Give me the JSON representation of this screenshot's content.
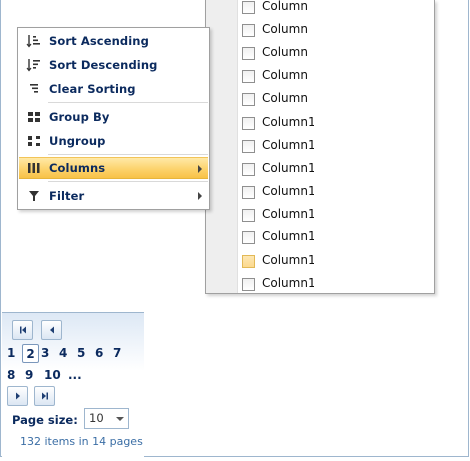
{
  "context_menu": {
    "items": [
      {
        "label": "Sort Ascending",
        "icon": "sort-ascending-icon"
      },
      {
        "label": "Sort Descending",
        "icon": "sort-descending-icon"
      },
      {
        "label": "Clear Sorting",
        "icon": "clear-sorting-icon"
      },
      {
        "label": "Group By",
        "icon": "group-by-icon"
      },
      {
        "label": "Ungroup",
        "icon": "ungroup-icon"
      },
      {
        "label": "Columns",
        "icon": "columns-icon",
        "has_submenu": true,
        "highlighted": true
      },
      {
        "label": "Filter",
        "icon": "filter-icon",
        "has_submenu": true
      }
    ],
    "highlight_color": "#fcd36d"
  },
  "columns_submenu": {
    "items": [
      {
        "label": "Column"
      },
      {
        "label": "Column"
      },
      {
        "label": "Column"
      },
      {
        "label": "Column"
      },
      {
        "label": "Column"
      },
      {
        "label": "Column1"
      },
      {
        "label": "Column1"
      },
      {
        "label": "Column1"
      },
      {
        "label": "Column1"
      },
      {
        "label": "Column1"
      },
      {
        "label": "Column1"
      },
      {
        "label": "Column1",
        "hover": true
      },
      {
        "label": "Column1"
      }
    ]
  },
  "pager": {
    "pages_row1": [
      "1",
      "2",
      "3",
      "4",
      "5",
      "6",
      "7"
    ],
    "pages_row2": [
      "8",
      "9",
      "10",
      "..."
    ],
    "current_page": "2",
    "page_size_label": "Page size:",
    "page_size_value": "10",
    "info": "132 items in 14 pages",
    "accent": "#0b2a5e"
  }
}
